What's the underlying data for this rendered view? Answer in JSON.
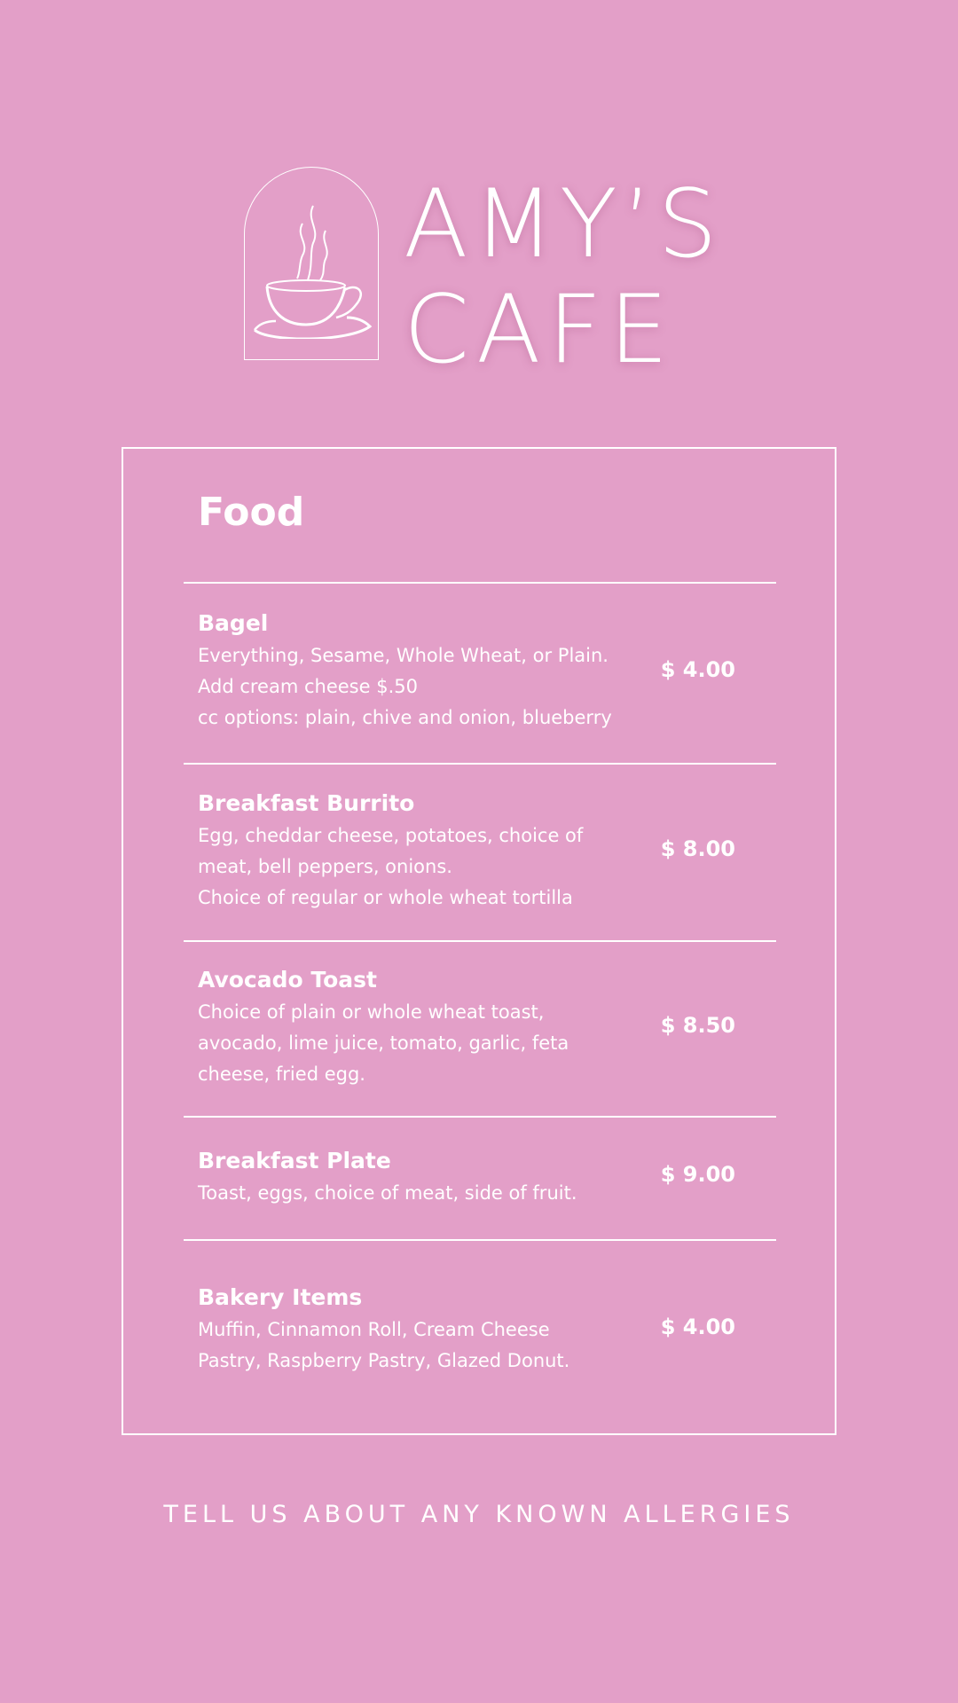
{
  "logo": {
    "line1": "AMY’S",
    "line2": "CAFE",
    "icon": "coffee-cup-icon"
  },
  "menu": {
    "section_title": "Food",
    "items": [
      {
        "name": "Bagel",
        "desc": [
          "Everything, Sesame, Whole Wheat, or Plain.",
          "Add cream cheese $.50",
          "cc options: plain, chive and onion, blueberry"
        ],
        "price": "$ 4.00"
      },
      {
        "name": "Breakfast Burrito",
        "desc": [
          "Egg, cheddar cheese, potatoes, choice of",
          "meat, bell peppers, onions.",
          "Choice of regular or whole wheat tortilla"
        ],
        "price": "$ 8.00"
      },
      {
        "name": "Avocado Toast",
        "desc": [
          "Choice of plain or whole wheat toast,",
          "avocado, lime juice, tomato, garlic, feta",
          "cheese, fried egg."
        ],
        "price": "$ 8.50"
      },
      {
        "name": "Breakfast Plate",
        "desc": [
          "Toast, eggs, choice of meat, side of fruit."
        ],
        "price": "$ 9.00"
      },
      {
        "name": "Bakery Items",
        "desc": [
          "Muffin, Cinnamon Roll, Cream Cheese",
          "Pastry, Raspberry Pastry, Glazed Donut."
        ],
        "price": "$ 4.00"
      }
    ]
  },
  "footer": {
    "note": "TELL US ABOUT ANY KNOWN ALLERGIES"
  },
  "colors": {
    "background": "#e39fc8",
    "foreground": "#ffffff"
  }
}
